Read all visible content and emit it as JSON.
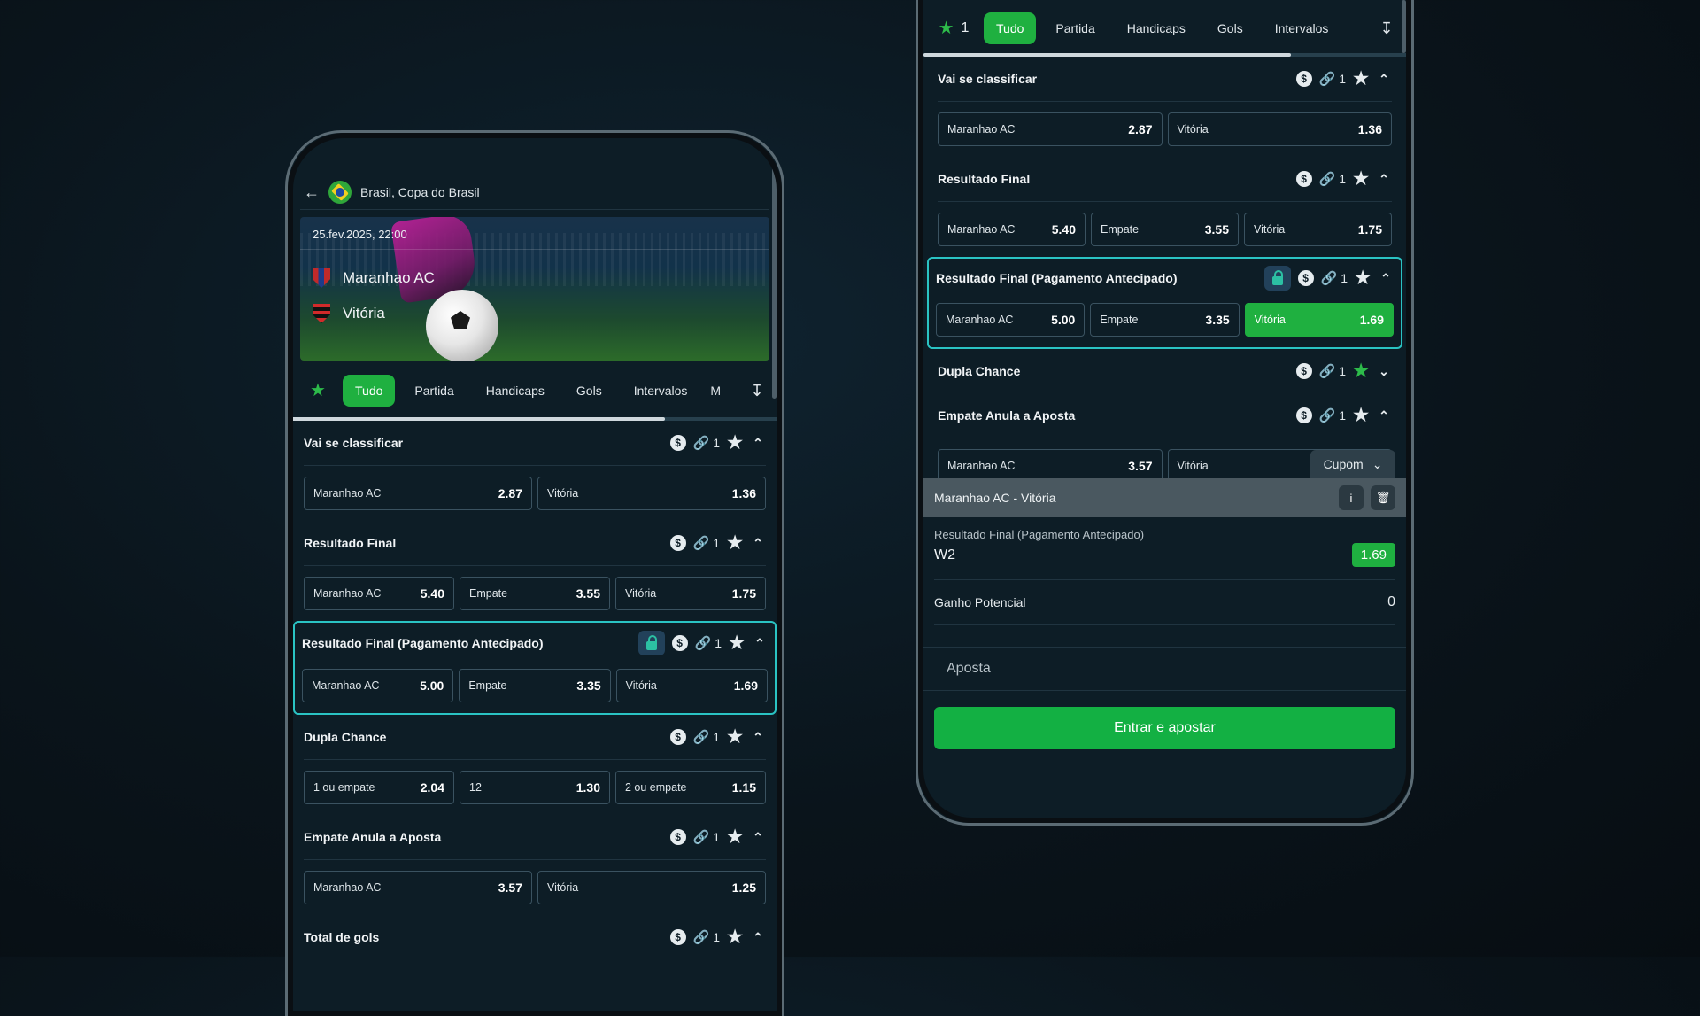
{
  "left": {
    "header": {
      "title": "Brasil, Copa do Brasil"
    },
    "match": {
      "datetime": "25.fev.2025, 22:00",
      "home": "Maranhao AC",
      "away": "Vitória"
    },
    "tabs": [
      "Tudo",
      "Partida",
      "Handicaps",
      "Gols",
      "Intervalos",
      "M"
    ],
    "markets": [
      {
        "title": "Vai se classificar",
        "count": "1",
        "odds": [
          {
            "label": "Maranhao AC",
            "value": "2.87"
          },
          {
            "label": "Vitória",
            "value": "1.36"
          }
        ]
      },
      {
        "title": "Resultado Final",
        "count": "1",
        "odds": [
          {
            "label": "Maranhao AC",
            "value": "5.40"
          },
          {
            "label": "Empate",
            "value": "3.55"
          },
          {
            "label": "Vitória",
            "value": "1.75"
          }
        ]
      },
      {
        "title": "Resultado Final (Pagamento Antecipado)",
        "count": "1",
        "odds": [
          {
            "label": "Maranhao AC",
            "value": "5.00"
          },
          {
            "label": "Empate",
            "value": "3.35"
          },
          {
            "label": "Vitória",
            "value": "1.69"
          }
        ]
      },
      {
        "title": "Dupla Chance",
        "count": "1",
        "odds": [
          {
            "label": "1 ou empate",
            "value": "2.04"
          },
          {
            "label": "12",
            "value": "1.30"
          },
          {
            "label": "2 ou empate",
            "value": "1.15"
          }
        ]
      },
      {
        "title": "Empate Anula a Aposta",
        "count": "1",
        "odds": [
          {
            "label": "Maranhao AC",
            "value": "3.57"
          },
          {
            "label": "Vitória",
            "value": "1.25"
          }
        ]
      },
      {
        "title": "Total de gols",
        "count": "1"
      }
    ]
  },
  "right": {
    "fav_count": "1",
    "tabs": [
      "Tudo",
      "Partida",
      "Handicaps",
      "Gols",
      "Intervalos"
    ],
    "markets": [
      {
        "title": "Vai se classificar",
        "count": "1",
        "odds": [
          {
            "label": "Maranhao AC",
            "value": "2.87"
          },
          {
            "label": "Vitória",
            "value": "1.36"
          }
        ]
      },
      {
        "title": "Resultado Final",
        "count": "1",
        "odds": [
          {
            "label": "Maranhao AC",
            "value": "5.40"
          },
          {
            "label": "Empate",
            "value": "3.55"
          },
          {
            "label": "Vitória",
            "value": "1.75"
          }
        ]
      },
      {
        "title": "Resultado Final (Pagamento Antecipado)",
        "count": "1",
        "odds": [
          {
            "label": "Maranhao AC",
            "value": "5.00"
          },
          {
            "label": "Empate",
            "value": "3.35"
          },
          {
            "label": "Vitória",
            "value": "1.69"
          }
        ]
      },
      {
        "title": "Dupla Chance",
        "count": "1"
      },
      {
        "title": "Empate Anula a Aposta",
        "count": "1",
        "odds": [
          {
            "label": "Maranhao AC",
            "value": "3.57"
          },
          {
            "label": "Vitória",
            "value": ""
          }
        ]
      }
    ],
    "coupon": {
      "tab_label": "Cupom",
      "event": "Maranhao AC - Vitória",
      "market": "Resultado Final (Pagamento Antecipado)",
      "selection": "W2",
      "odd": "1.69",
      "potential_label": "Ganho Potencial",
      "potential_value": "0",
      "stake_placeholder": "Aposta",
      "submit_label": "Entrar e apostar"
    }
  },
  "colors": {
    "accent": "#1fb040",
    "highlight": "#2ac3c3",
    "background": "#0d1d26"
  }
}
